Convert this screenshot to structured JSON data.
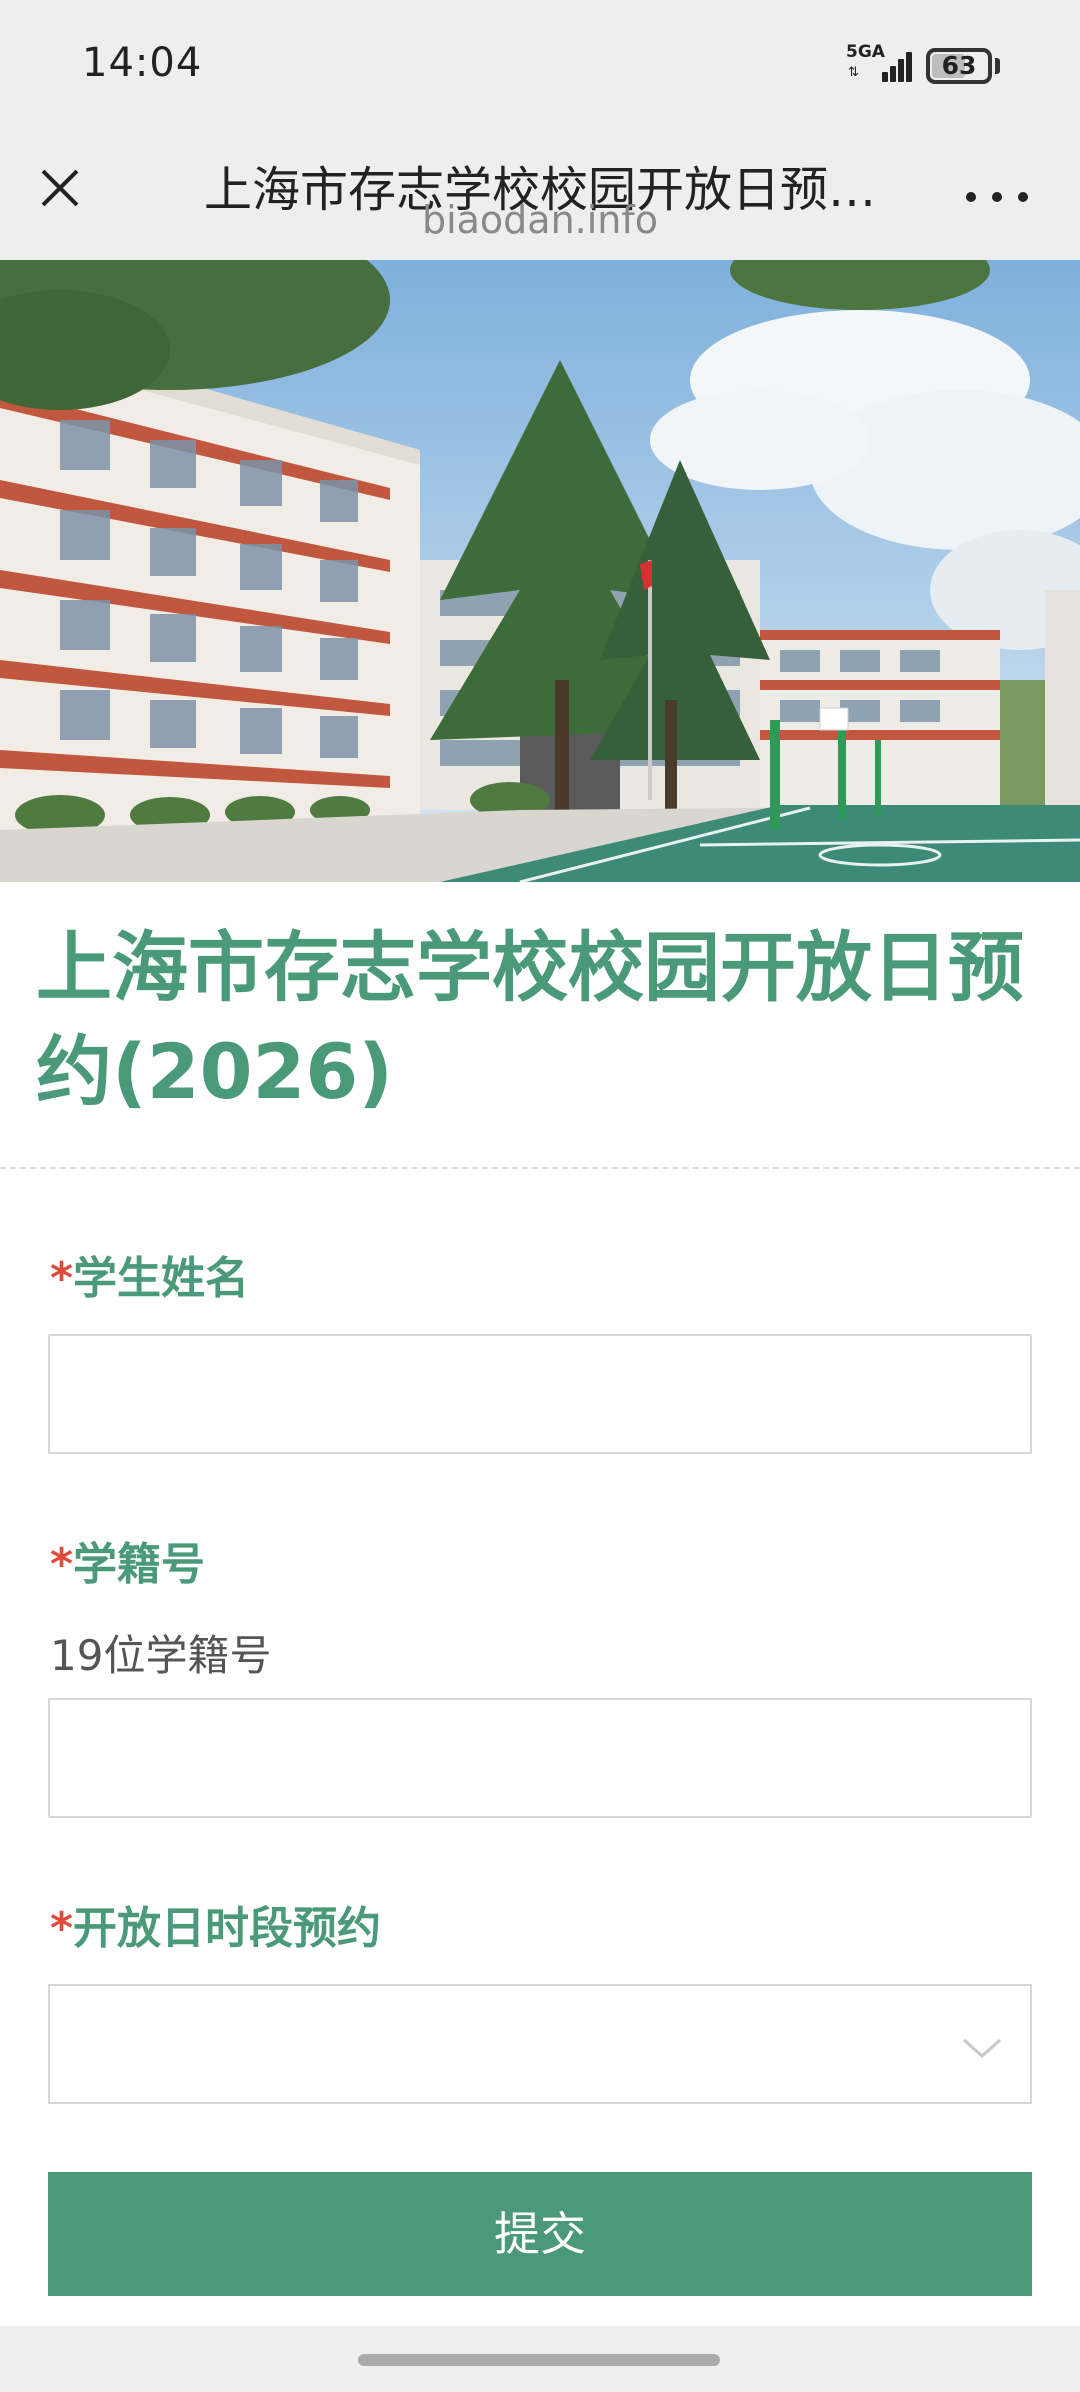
{
  "status_bar": {
    "time": "14:04",
    "network": "5GA",
    "battery_level": "63",
    "icons": [
      "signal-icon",
      "battery-icon"
    ]
  },
  "title_bar": {
    "title": "上海市存志学校校园开放日预…",
    "domain": "biaodan.info",
    "icons": [
      "close-icon",
      "more-icon"
    ]
  },
  "form": {
    "title": "上海市存志学校校园开放日预约(2026)",
    "fields": [
      {
        "required_mark": "*",
        "label": "学生姓名",
        "value": ""
      },
      {
        "required_mark": "*",
        "label": "学籍号",
        "description": "19位学籍号",
        "value": ""
      },
      {
        "required_mark": "*",
        "label": "开放日时段预约",
        "selected": ""
      }
    ],
    "submit_label": "提交"
  },
  "colors": {
    "accent": "#4a9a7a",
    "required": "#e04a3a",
    "chrome_bg": "#eeeeee"
  }
}
